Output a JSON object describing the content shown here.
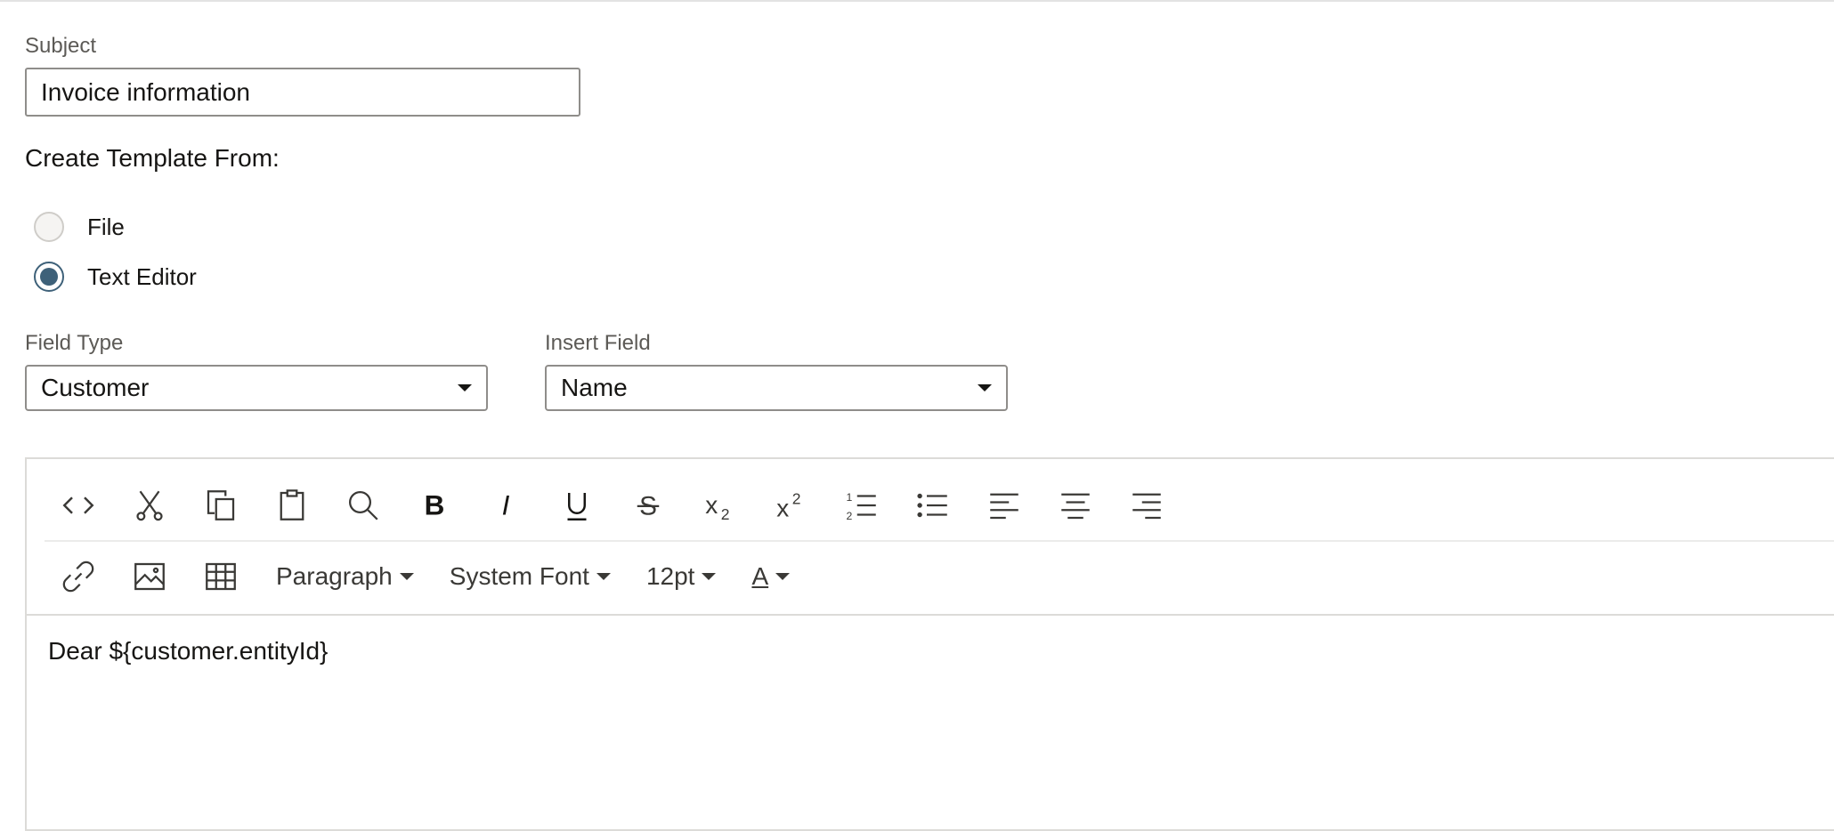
{
  "subject": {
    "label": "Subject",
    "value": "Invoice information"
  },
  "create_template": {
    "heading": "Create Template From:",
    "options": [
      {
        "label": "File",
        "selected": false
      },
      {
        "label": "Text Editor",
        "selected": true
      }
    ]
  },
  "field_type": {
    "label": "Field Type",
    "value": "Customer"
  },
  "insert_field": {
    "label": "Insert Field",
    "value": "Name"
  },
  "toolbar": {
    "row1": [
      "source-code-icon",
      "cut-icon",
      "copy-icon",
      "paste-icon",
      "find-icon",
      "bold-icon",
      "italic-icon",
      "underline-icon",
      "strikethrough-icon",
      "subscript-icon",
      "superscript-icon",
      "numbered-list-icon",
      "bulleted-list-icon",
      "align-left-icon",
      "align-center-icon",
      "align-right-icon"
    ],
    "row2": [
      "link-icon",
      "image-icon",
      "table-icon"
    ],
    "block_format": "Paragraph",
    "font_family": "System Font",
    "font_size": "12pt",
    "text_color_glyph": "A"
  },
  "editor": {
    "content": "Dear ${customer.entityId}"
  },
  "colors": {
    "radio_selected": "#3e6179",
    "border": "#8f8d8a",
    "text": "#161513"
  }
}
